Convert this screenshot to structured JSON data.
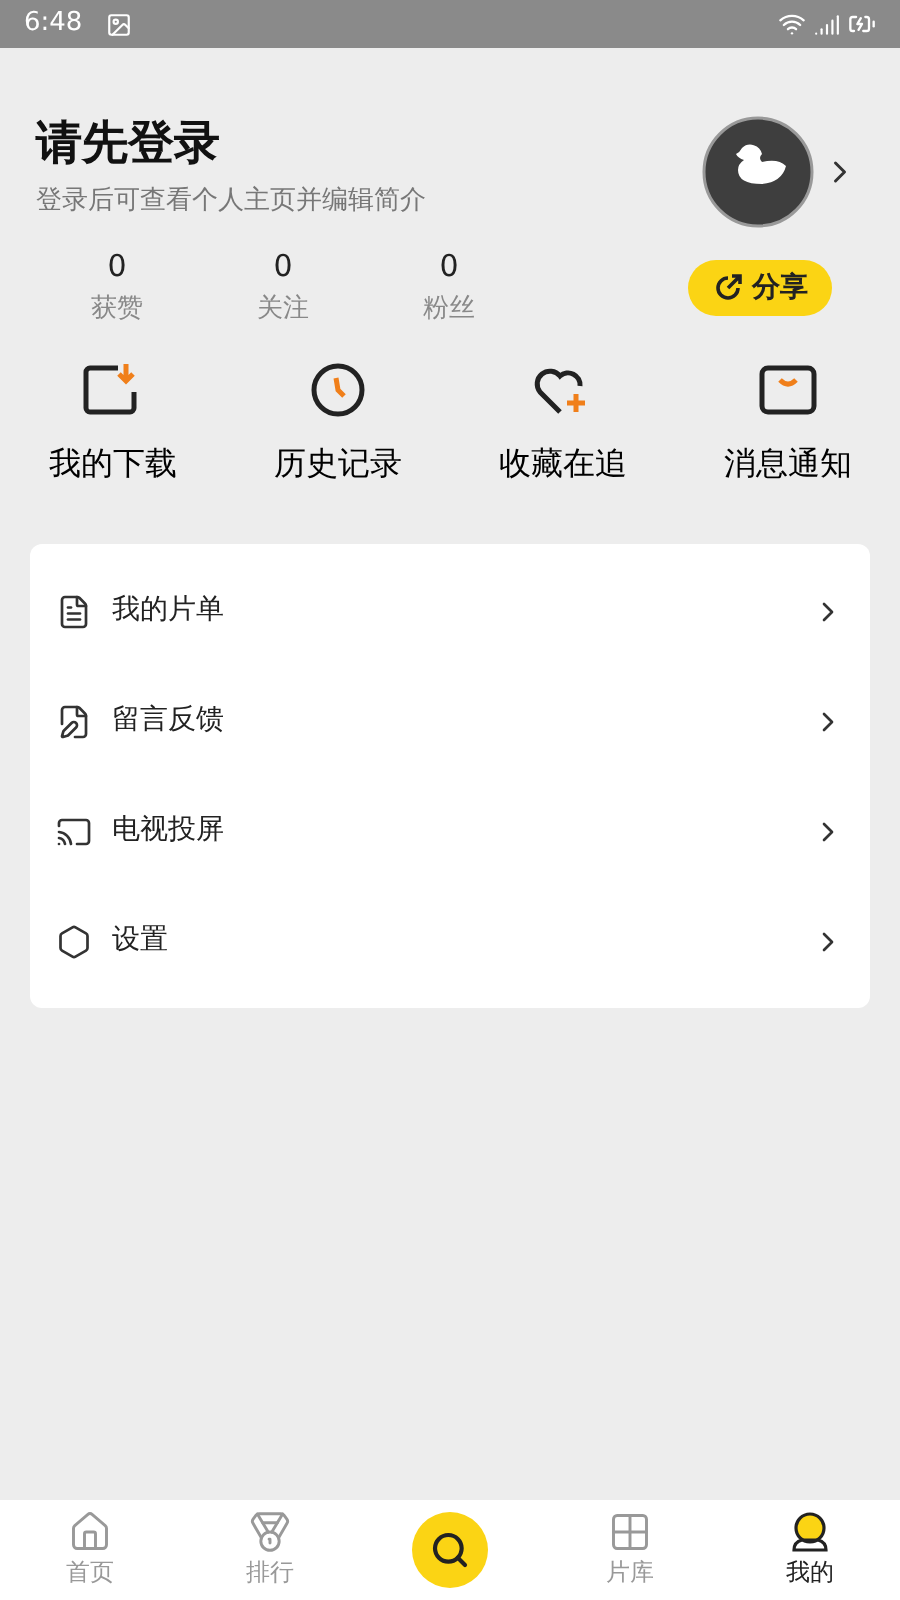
{
  "status_bar": {
    "time": "6:48"
  },
  "profile": {
    "title": "请先登录",
    "subtitle": "登录后可查看个人主页并编辑简介",
    "share": "分享"
  },
  "stats": [
    {
      "value": "0",
      "label": "获赞"
    },
    {
      "value": "0",
      "label": "关注"
    },
    {
      "value": "0",
      "label": "粉丝"
    }
  ],
  "shortcuts": [
    {
      "kind": "download",
      "label": "我的下载"
    },
    {
      "kind": "history",
      "label": "历史记录"
    },
    {
      "kind": "favorite",
      "label": "收藏在追"
    },
    {
      "kind": "message",
      "label": "消息通知"
    }
  ],
  "menu": [
    {
      "kind": "list",
      "label": "我的片单"
    },
    {
      "kind": "feedback",
      "label": "留言反馈"
    },
    {
      "kind": "cast",
      "label": "电视投屏"
    },
    {
      "kind": "settings",
      "label": "设置"
    }
  ],
  "nav": [
    {
      "kind": "home",
      "label": "首页",
      "selected": false
    },
    {
      "kind": "rank",
      "label": "排行",
      "selected": false
    },
    {
      "kind": "search",
      "selected": false
    },
    {
      "kind": "library",
      "label": "片库",
      "selected": false
    },
    {
      "kind": "me",
      "label": "我的",
      "selected": true
    }
  ]
}
